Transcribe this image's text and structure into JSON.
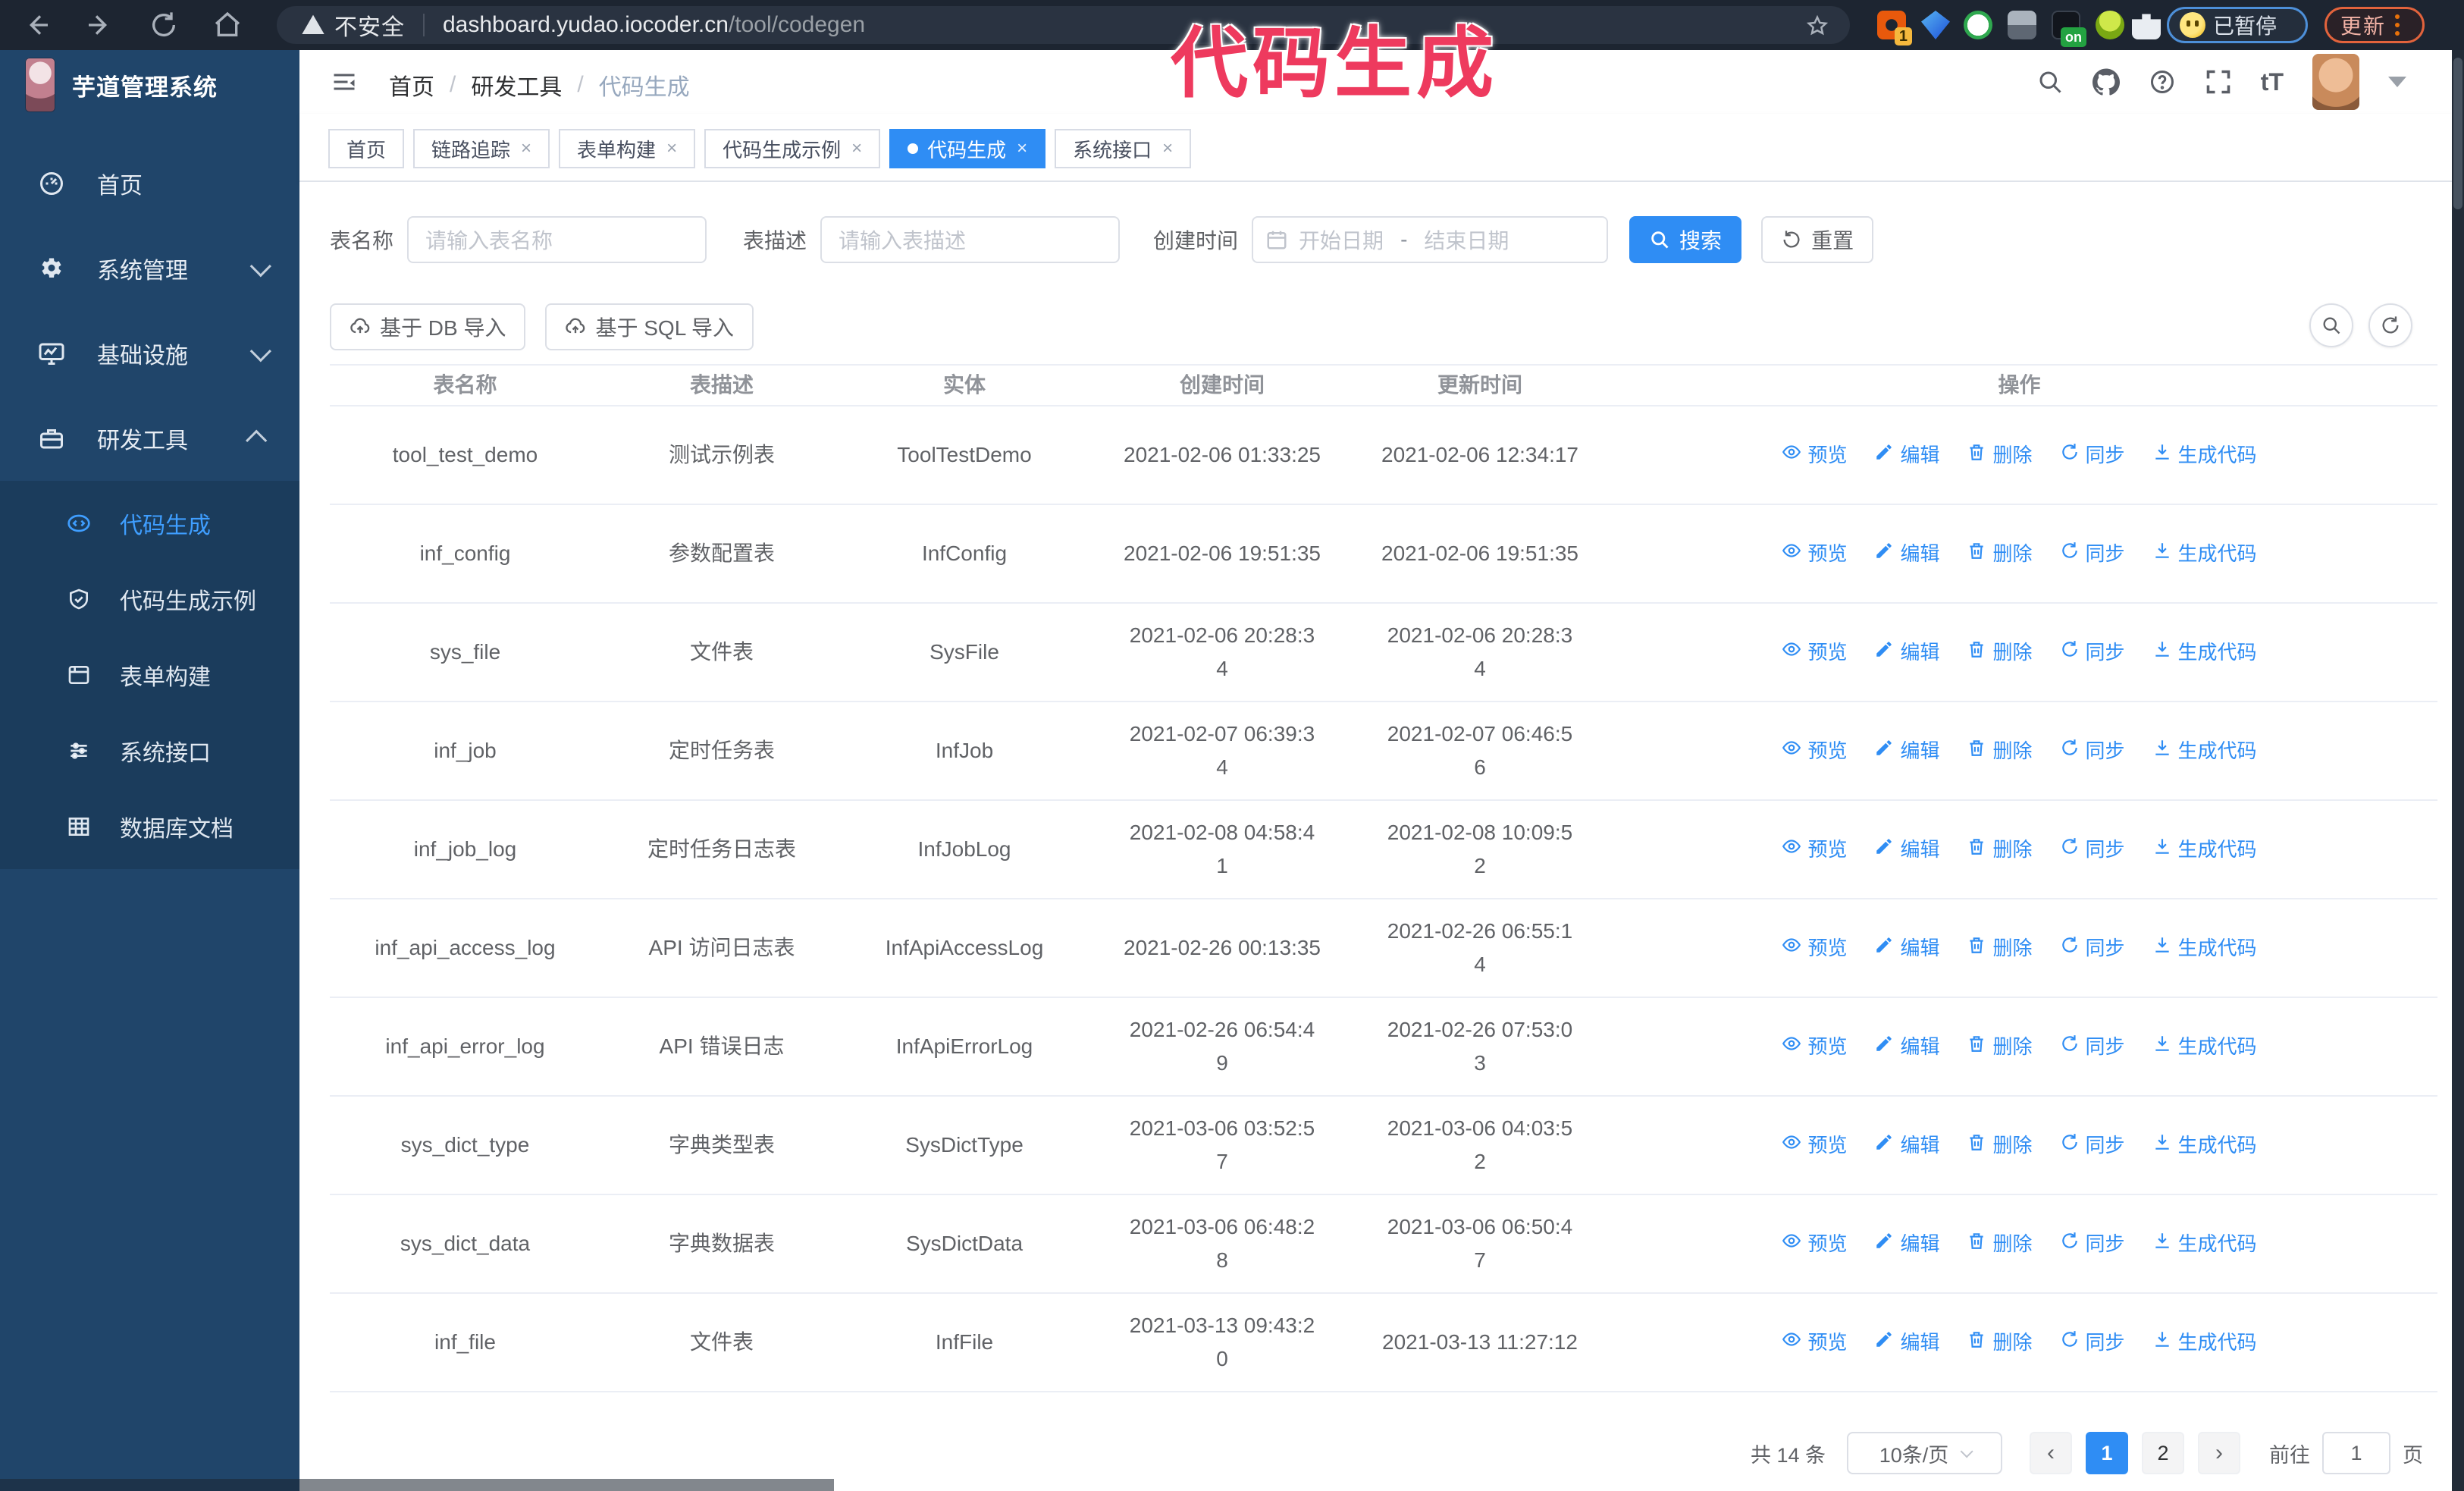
{
  "colors": {
    "accent": "#2f8df4",
    "sidebar": "#20456a",
    "submenu": "#1b3c5c",
    "chrome": "#1d2531",
    "annotation": "#ee3a5e"
  },
  "annotation": {
    "text": "代码生成"
  },
  "browser": {
    "security_label": "不安全",
    "url_host": "dashboard.yudao.iocoder.cn",
    "url_path": "/tool/codegen",
    "extension_badge": "1",
    "extension_on_badge": "on",
    "paused_badge": "已暂停",
    "update_button": "更新"
  },
  "sidebar": {
    "logo_title": "芋道管理系统",
    "items": [
      {
        "label": "首页",
        "icon": "dashboard-icon",
        "chevron": null
      },
      {
        "label": "系统管理",
        "icon": "gear-icon",
        "chevron": "down"
      },
      {
        "label": "基础设施",
        "icon": "monitor-icon",
        "chevron": "down"
      },
      {
        "label": "研发工具",
        "icon": "toolbox-icon",
        "chevron": "up"
      }
    ],
    "subitems": [
      {
        "label": "代码生成",
        "icon": "code-icon",
        "active": true
      },
      {
        "label": "代码生成示例",
        "icon": "example-icon",
        "active": false
      },
      {
        "label": "表单构建",
        "icon": "form-icon",
        "active": false
      },
      {
        "label": "系统接口",
        "icon": "api-icon",
        "active": false
      },
      {
        "label": "数据库文档",
        "icon": "database-icon",
        "active": false
      }
    ]
  },
  "header": {
    "breadcrumb": [
      "首页",
      "研发工具",
      "代码生成"
    ]
  },
  "tabs": [
    {
      "label": "首页",
      "closable": false,
      "active": false
    },
    {
      "label": "链路追踪",
      "closable": true,
      "active": false
    },
    {
      "label": "表单构建",
      "closable": true,
      "active": false
    },
    {
      "label": "代码生成示例",
      "closable": true,
      "active": false
    },
    {
      "label": "代码生成",
      "closable": true,
      "active": true
    },
    {
      "label": "系统接口",
      "closable": true,
      "active": false
    }
  ],
  "search": {
    "table_name_label": "表名称",
    "table_name_placeholder": "请输入表名称",
    "table_desc_label": "表描述",
    "table_desc_placeholder": "请输入表描述",
    "create_time_label": "创建时间",
    "date_start_placeholder": "开始日期",
    "date_separator": "-",
    "date_end_placeholder": "结束日期",
    "search_button": "搜索",
    "reset_button": "重置"
  },
  "toolbar": {
    "import_db_button": "基于 DB 导入",
    "import_sql_button": "基于 SQL 导入"
  },
  "table": {
    "columns": [
      "表名称",
      "表描述",
      "实体",
      "创建时间",
      "更新时间",
      "操作"
    ],
    "action_labels": [
      "预览",
      "编辑",
      "删除",
      "同步",
      "生成代码"
    ],
    "action_icons": [
      "eye-icon",
      "edit-icon",
      "delete-icon",
      "sync-icon",
      "download-icon"
    ],
    "rows": [
      {
        "name": "tool_test_demo",
        "desc": "测试示例表",
        "entity": "ToolTestDemo",
        "created": "2021-02-06 01:33:25",
        "updated": "2021-02-06 12:34:17"
      },
      {
        "name": "inf_config",
        "desc": "参数配置表",
        "entity": "InfConfig",
        "created": "2021-02-06 19:51:35",
        "updated": "2021-02-06 19:51:35"
      },
      {
        "name": "sys_file",
        "desc": "文件表",
        "entity": "SysFile",
        "created": [
          "2021-02-06 20:28:3",
          "4"
        ],
        "updated": [
          "2021-02-06 20:28:3",
          "4"
        ]
      },
      {
        "name": "inf_job",
        "desc": "定时任务表",
        "entity": "InfJob",
        "created": [
          "2021-02-07 06:39:3",
          "4"
        ],
        "updated": [
          "2021-02-07 06:46:5",
          "6"
        ]
      },
      {
        "name": "inf_job_log",
        "desc": "定时任务日志表",
        "entity": "InfJobLog",
        "created": [
          "2021-02-08 04:58:4",
          "1"
        ],
        "updated": [
          "2021-02-08 10:09:5",
          "2"
        ]
      },
      {
        "name": "inf_api_access_log",
        "desc": "API 访问日志表",
        "entity": "InfApiAccessLog",
        "created": "2021-02-26 00:13:35",
        "updated": [
          "2021-02-26 06:55:1",
          "4"
        ]
      },
      {
        "name": "inf_api_error_log",
        "desc": "API 错误日志",
        "entity": "InfApiErrorLog",
        "created": [
          "2021-02-26 06:54:4",
          "9"
        ],
        "updated": [
          "2021-02-26 07:53:0",
          "3"
        ]
      },
      {
        "name": "sys_dict_type",
        "desc": "字典类型表",
        "entity": "SysDictType",
        "created": [
          "2021-03-06 03:52:5",
          "7"
        ],
        "updated": [
          "2021-03-06 04:03:5",
          "2"
        ]
      },
      {
        "name": "sys_dict_data",
        "desc": "字典数据表",
        "entity": "SysDictData",
        "created": [
          "2021-03-06 06:48:2",
          "8"
        ],
        "updated": [
          "2021-03-06 06:50:4",
          "7"
        ]
      },
      {
        "name": "inf_file",
        "desc": "文件表",
        "entity": "InfFile",
        "created": [
          "2021-03-13 09:43:2",
          "0"
        ],
        "updated": "2021-03-13 11:27:12"
      }
    ]
  },
  "pagination": {
    "total": "共 14 条",
    "page_size": "10条/页",
    "pages": [
      "1",
      "2"
    ],
    "active_page": "1",
    "goto_label": "前往",
    "goto_value": "1",
    "goto_suffix": "页"
  }
}
